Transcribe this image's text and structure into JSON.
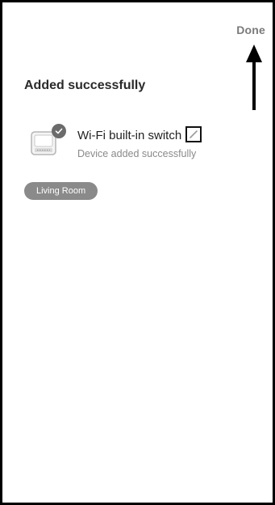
{
  "header": {
    "done_label": "Done"
  },
  "page": {
    "title": "Added successfully"
  },
  "device": {
    "name": "Wi-Fi built-in switch",
    "status": "Device added successfully",
    "icon": "switch-module-icon",
    "edit_icon": "pencil-icon",
    "check_icon": "check-icon"
  },
  "room": {
    "label": "Living Room"
  },
  "colors": {
    "chip_background": "#8a8a8a",
    "muted_text": "#8a8a8a",
    "annotation": "#000000"
  }
}
